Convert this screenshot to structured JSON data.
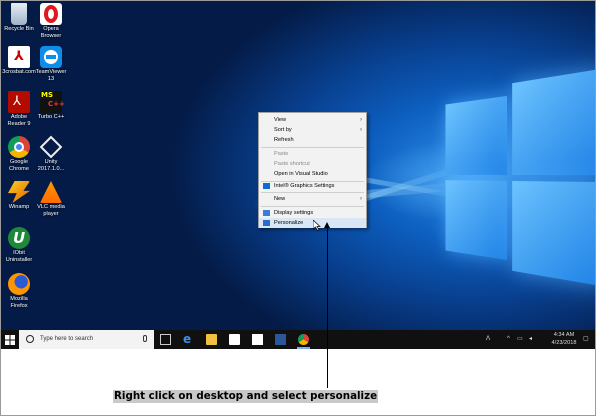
{
  "desktop_icons": [
    {
      "label": "Recycle Bin",
      "icon": "recycle-bin-icon"
    },
    {
      "label": "Opera Browser",
      "icon": "opera-icon"
    },
    {
      "label": "3crosbat.com",
      "icon": "pdf-icon"
    },
    {
      "label": "TeamViewer 13",
      "icon": "teamviewer-icon"
    },
    {
      "label": "Adobe Reader 9",
      "icon": "adobe-reader-icon"
    },
    {
      "label": "Turbo C++",
      "icon": "turbo-cpp-icon"
    },
    {
      "label": "Google Chrome",
      "icon": "chrome-icon"
    },
    {
      "label": "Unity 2017.1.0...",
      "icon": "unity-icon"
    },
    {
      "label": "Winamp",
      "icon": "winamp-icon"
    },
    {
      "label": "VLC media player",
      "icon": "vlc-icon"
    },
    {
      "label": "IObit Uninstaller",
      "icon": "iobit-icon"
    },
    {
      "label": "Mozilla Firefox",
      "icon": "firefox-icon"
    }
  ],
  "context_menu": {
    "view": "View",
    "sort_by": "Sort by",
    "refresh": "Refresh",
    "paste": "Paste",
    "paste_shortcut": "Paste shortcut",
    "open_vs": "Open in Visual Studio",
    "intel": "Intel® Graphics Settings",
    "new": "New",
    "display": "Display settings",
    "personalize": "Personalize"
  },
  "taskbar": {
    "search_placeholder": "Type here to search",
    "time": "4:34 AM",
    "date": "4/23/2018"
  },
  "caption": "Right click on desktop and select personalize",
  "colors": {
    "accent": "#0d5fc0",
    "taskbar": "#101010"
  }
}
